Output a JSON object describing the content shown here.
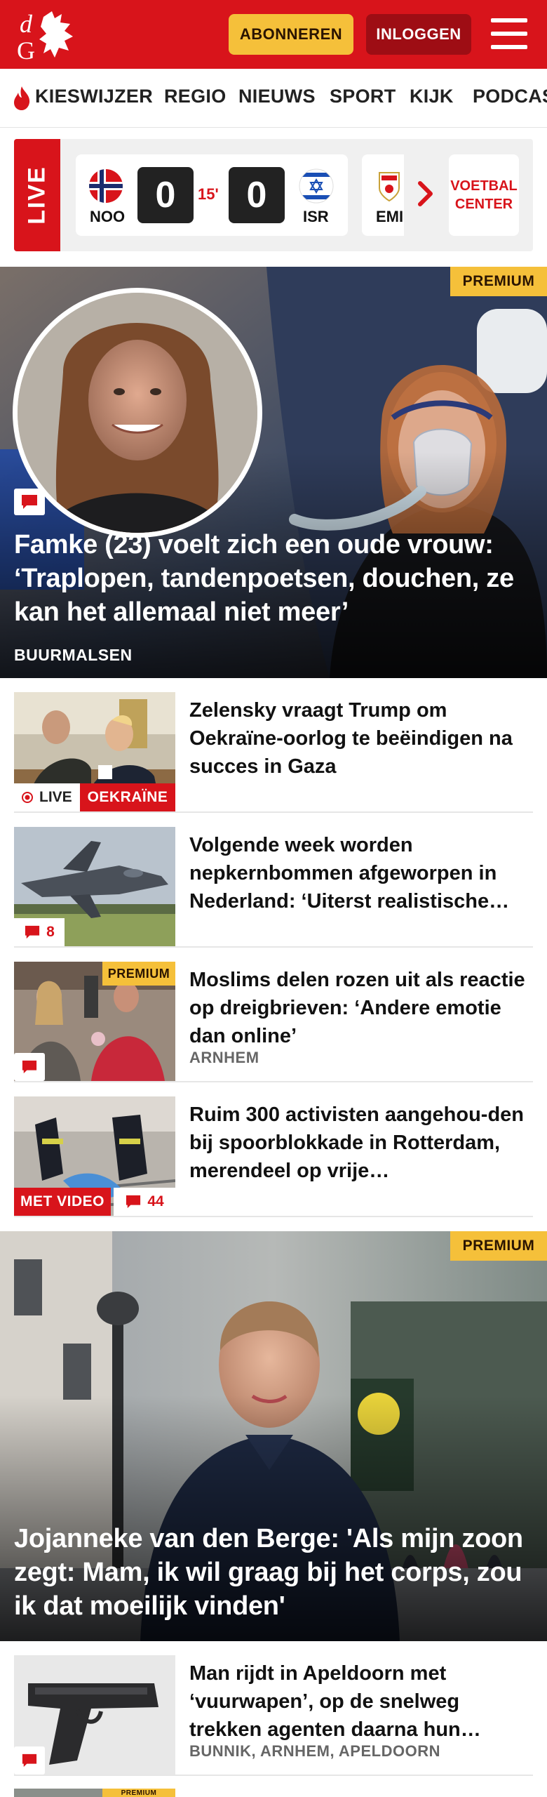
{
  "header": {
    "logo_text": "dG",
    "subscribe_label": "ABONNEREN",
    "login_label": "INLOGGEN",
    "brand_color": "#d8141b"
  },
  "nav": {
    "items": [
      {
        "label": "KIESWIJZER"
      },
      {
        "label": "REGIO"
      },
      {
        "label": "NIEUWS"
      },
      {
        "label": "SPORT"
      },
      {
        "label": "KIJK"
      },
      {
        "label": "PODCAST"
      }
    ]
  },
  "scores": {
    "live_label": "LIVE",
    "match": {
      "home_team": "NOO",
      "away_team": "ISR",
      "home_score": "0",
      "away_score": "0",
      "minute": "15'"
    },
    "next_match_team": "EMI",
    "football_center_label": "VOETBAL CENTER"
  },
  "hero": {
    "premium_label": "PREMIUM",
    "title": "Famke (23) voelt zich een oude vrouw: ‘Traplopen, tandenpoetsen, douchen, ze kan het allemaal niet meer’",
    "location": "BUURMALSEN"
  },
  "articles": [
    {
      "title": "Zelensky vraagt Trump om Oekraïne-oorlog te beëindigen na succes in Gaza",
      "live_label": "LIVE",
      "tag": "OEKRAÏNE"
    },
    {
      "title": "Volgende week worden nepkernbommen afgeworpen in Nederland: ‘Uiterst realistische…",
      "comments": "8"
    },
    {
      "title": "Moslims delen rozen uit als reactie op dreigbrieven: ‘Andere emotie dan online’",
      "premium_label": "PREMIUM",
      "location": "ARNHEM"
    },
    {
      "title": "Ruim 300 activisten aangehou-den bij spoorblokkade in Rotterdam, merendeel op vrije…",
      "video_label": "MET VIDEO",
      "comments": "44"
    }
  ],
  "feature": {
    "premium_label": "PREMIUM",
    "title": "Jojanneke van den Berge: 'Als mijn zoon zegt: Mam, ik wil graag bij het corps, zou ik dat moeilijk vinden'"
  },
  "articles2": [
    {
      "title": "Man rijdt in Apeldoorn met ‘vuurwapen’, op de snelweg trekken agenten daarna hun…",
      "location": "BUNNIK, ARNHEM, APELDOORN"
    },
    {
      "premium_label": "PREMIUM"
    }
  ]
}
